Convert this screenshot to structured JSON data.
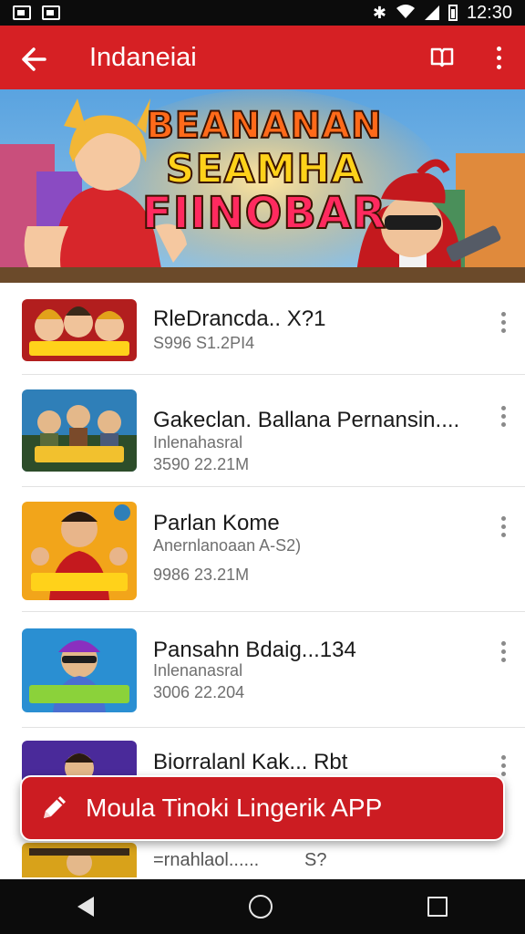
{
  "status_bar": {
    "time": "12:30",
    "icons": [
      "image-icon",
      "photo-icon",
      "bluetooth-icon",
      "wifi-icon",
      "signal-icon",
      "battery-icon"
    ]
  },
  "app_bar": {
    "title": "Indaneiai",
    "back_icon": "arrow-left-icon",
    "bookmark_icon": "book-icon",
    "more_icon": "vertical-dots-icon"
  },
  "banner": {
    "line1": "BEANANAN",
    "line2": "SEAMHA",
    "line3": "FIINOBAR"
  },
  "items": [
    {
      "thumb_text": "BUONAHKAK",
      "title": "RleDrancda.. X?1",
      "subtitle": "",
      "meta": "S996 S1.2PI4"
    },
    {
      "thumb_text": "GUIDMERS",
      "title": "Gakeclan. Ballana Pernansin....",
      "subtitle": "Inlenahasral",
      "meta": "3590 22.21M"
    },
    {
      "thumb_text": "MISNTAN",
      "title": "Parlan Kome",
      "subtitle": "Anernlanoaan A-S2)",
      "meta": "9986 23.21M"
    },
    {
      "thumb_text": "SHOMNNELS",
      "title": "Pansahn Bdaig...134",
      "subtitle": "Inlenanasral",
      "meta": "3006 22.204"
    },
    {
      "thumb_text": "",
      "title": "Biorralanl Kak... Rbt",
      "subtitle": "",
      "meta": ""
    },
    {
      "thumb_text": "",
      "title": "=rnahlaol......",
      "subtitle": "",
      "meta": "S?"
    }
  ],
  "cta": {
    "label": "Moula Tinoki Lingerik APP",
    "icon": "pencil-icon"
  },
  "nav": {
    "back": "triangle-back-icon",
    "home": "circle-home-icon",
    "recents": "square-recents-icon"
  },
  "colors": {
    "primary": "#d62024",
    "cta": "#cc1c22",
    "text": "#1a1a1a",
    "muted": "#6f6f6f"
  }
}
